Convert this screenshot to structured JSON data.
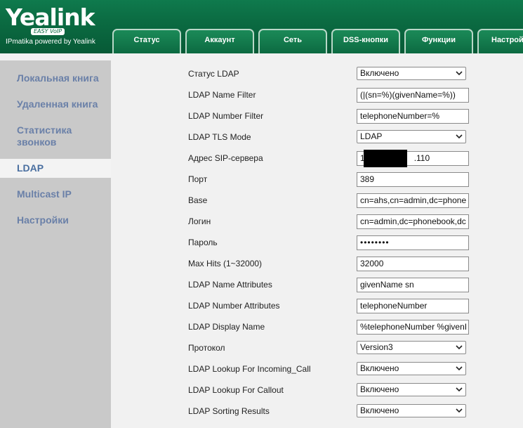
{
  "brand": {
    "logo": "Yealink",
    "tagline": "EASY VoIP",
    "subtitle": "IPmatika powered by Yealink"
  },
  "tabs": [
    {
      "label": "Статус"
    },
    {
      "label": "Аккаунт"
    },
    {
      "label": "Сеть"
    },
    {
      "label": "DSS-кнопки"
    },
    {
      "label": "Функции"
    },
    {
      "label": "Настрой"
    }
  ],
  "sidebar": {
    "items": [
      {
        "label": "Локальная книга"
      },
      {
        "label": "Удаленная книга"
      },
      {
        "label": "Статистика звонков"
      },
      {
        "label": "LDAP"
      },
      {
        "label": "Multicast IP"
      },
      {
        "label": "Настройки"
      }
    ],
    "active_index": 3
  },
  "form": {
    "status_ldap": {
      "label": "Статус LDAP",
      "value": "Включено"
    },
    "name_filter": {
      "label": "LDAP Name Filter",
      "value": "(|(sn=%)(givenName=%))"
    },
    "number_filter": {
      "label": "LDAP Number Filter",
      "value": "telephoneNumber=%"
    },
    "tls_mode": {
      "label": "LDAP TLS Mode",
      "value": "LDAP"
    },
    "server": {
      "label": "Адрес SIP-сервера",
      "value_prefix": "1",
      "value_suffix": ".110"
    },
    "port": {
      "label": "Порт",
      "value": "389"
    },
    "base": {
      "label": "Base",
      "value": "cn=ahs,cn=admin,dc=phone"
    },
    "login": {
      "label": "Логин",
      "value": "cn=admin,dc=phonebook,dc"
    },
    "password": {
      "label": "Пароль",
      "value": "••••••••"
    },
    "max_hits": {
      "label": "Max Hits (1~32000)",
      "value": "32000"
    },
    "name_attributes": {
      "label": "LDAP Name Attributes",
      "value": "givenName sn"
    },
    "number_attributes": {
      "label": "LDAP Number Attributes",
      "value": "telephoneNumber"
    },
    "display_name": {
      "label": "LDAP Display Name",
      "value": "%telephoneNumber %givenI"
    },
    "protocol": {
      "label": "Протокол",
      "value": "Version3"
    },
    "lookup_incoming": {
      "label": "LDAP Lookup For Incoming_Call",
      "value": "Включено"
    },
    "lookup_callout": {
      "label": "LDAP Lookup For Callout",
      "value": "Включено"
    },
    "sorting": {
      "label": "LDAP Sorting Results",
      "value": "Включено"
    }
  }
}
